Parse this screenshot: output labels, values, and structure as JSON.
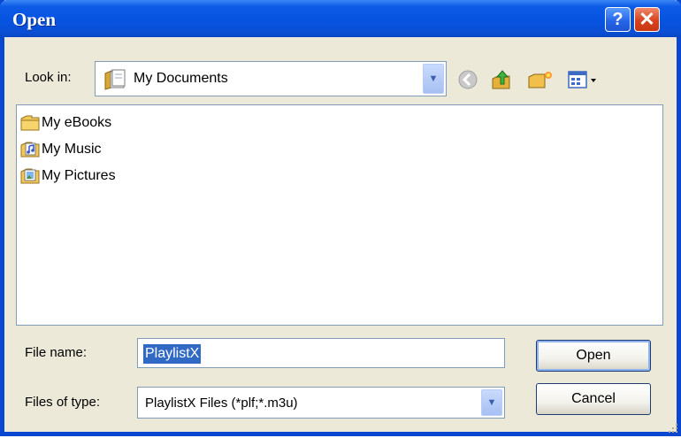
{
  "window": {
    "title": "Open",
    "help_symbol": "?",
    "close_symbol": "✕"
  },
  "lookin": {
    "label": "Look in:",
    "value": "My Documents"
  },
  "toolbar_icons": [
    "back-icon",
    "up-folder-icon",
    "new-folder-icon",
    "view-menu-icon"
  ],
  "files": [
    {
      "name": "My eBooks",
      "icon": "folder-icon"
    },
    {
      "name": "My Music",
      "icon": "music-folder-icon"
    },
    {
      "name": "My Pictures",
      "icon": "pictures-folder-icon"
    }
  ],
  "filename": {
    "label": "File name:",
    "value": "PlaylistX"
  },
  "filetype": {
    "label": "Files of type:",
    "value": "PlaylistX Files (*plf;*.m3u)"
  },
  "buttons": {
    "open": "Open",
    "cancel": "Cancel"
  },
  "colors": {
    "titlebar": "#0653e0",
    "dialog_bg": "#ece9d8",
    "selection": "#316ac5",
    "close": "#d8421f"
  }
}
